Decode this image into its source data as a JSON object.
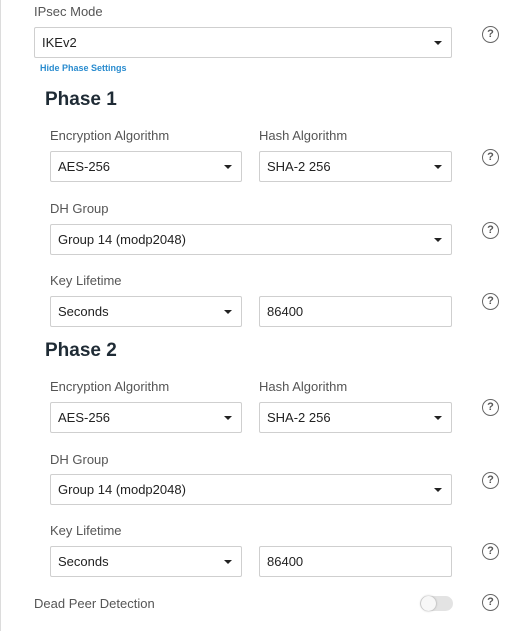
{
  "ipsec_mode": {
    "label": "IPsec Mode",
    "value": "IKEv2"
  },
  "phase_toggle_label": "Hide Phase Settings",
  "phase1": {
    "title": "Phase 1",
    "encryption_label": "Encryption Algorithm",
    "encryption_value": "AES-256",
    "hash_label": "Hash Algorithm",
    "hash_value": "SHA-2 256",
    "dh_label": "DH Group",
    "dh_value": "Group 14 (modp2048)",
    "lifetime_label": "Key Lifetime",
    "lifetime_unit": "Seconds",
    "lifetime_value": "86400"
  },
  "phase2": {
    "title": "Phase 2",
    "encryption_label": "Encryption Algorithm",
    "encryption_value": "AES-256",
    "hash_label": "Hash Algorithm",
    "hash_value": "SHA-2 256",
    "dh_label": "DH Group",
    "dh_value": "Group 14 (modp2048)",
    "lifetime_label": "Key Lifetime",
    "lifetime_unit": "Seconds",
    "lifetime_value": "86400"
  },
  "dead_peer_detection": {
    "label": "Dead Peer Detection",
    "enabled": false
  },
  "help_glyph": "?",
  "icons": {
    "help": "help-circle-icon",
    "dropdown": "caret-down-icon"
  },
  "colors": {
    "link": "#2a8ccf",
    "heading": "#1f2b35",
    "border": "#cfcfcf",
    "toggle_off": "#e3e3e3"
  }
}
